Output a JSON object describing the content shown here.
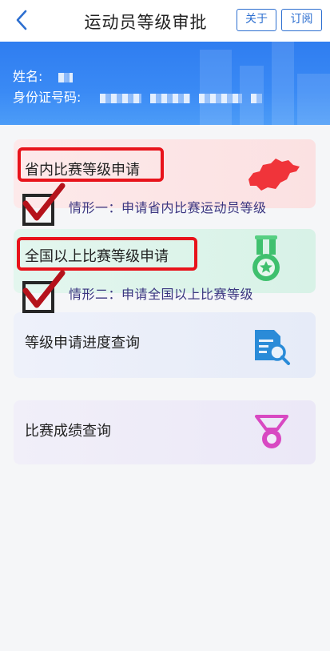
{
  "header": {
    "title": "运动员等级审批",
    "about_label": "关于",
    "subscribe_label": "订阅"
  },
  "profile": {
    "name_label": "姓名:",
    "id_label": "身份证号码:"
  },
  "cards": [
    {
      "title": "省内比赛等级申请",
      "icon": "province-map-icon"
    },
    {
      "title": "全国以上比赛等级申请",
      "icon": "medal-icon"
    },
    {
      "title": "等级申请进度查询",
      "icon": "document-search-icon"
    },
    {
      "title": "比赛成绩查询",
      "icon": "award-medal-icon"
    }
  ],
  "annotations": {
    "note1": "情形一：申请省内比赛运动员等级",
    "note2": "情形二：申请全国以上比赛等级"
  },
  "colors": {
    "accent": "#2d6fd0",
    "banner": "#3a8af5",
    "highlight": "#e8131b"
  }
}
